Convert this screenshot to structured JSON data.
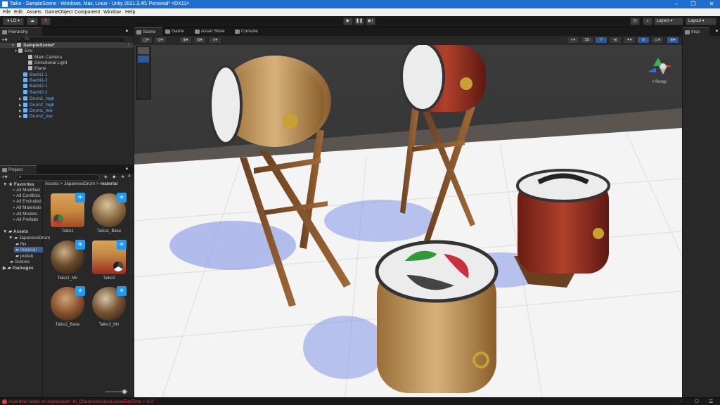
{
  "window": {
    "title": "Taiko - SampleScene - Windows, Mac, Linux - Unity 2021.3.4f1 Personal* <DX11>"
  },
  "menu": [
    "File",
    "Edit",
    "Assets",
    "GameObject",
    "Component",
    "Window",
    "Help"
  ],
  "toolbar": {
    "account": "LO",
    "layers_label": "Layers",
    "layout_label": "Layout"
  },
  "hierarchy": {
    "tab_label": "Hierarchy",
    "search_placeholder": "All",
    "scene": "SampleScene*",
    "items": [
      {
        "label": "Env",
        "kind": "folder"
      },
      {
        "label": "Main Camera",
        "kind": "go"
      },
      {
        "label": "Directional Light",
        "kind": "go"
      },
      {
        "label": "Plane",
        "kind": "go"
      },
      {
        "label": "Bachi1-1",
        "kind": "prefab"
      },
      {
        "label": "Bachi1-2",
        "kind": "prefab"
      },
      {
        "label": "Bachi2-1",
        "kind": "prefab"
      },
      {
        "label": "Bachi2-2",
        "kind": "prefab"
      },
      {
        "label": "Drum1_high",
        "kind": "prefab"
      },
      {
        "label": "Drum2_high",
        "kind": "prefab"
      },
      {
        "label": "Drum1_low",
        "kind": "prefab"
      },
      {
        "label": "Drum2_low",
        "kind": "prefab"
      }
    ]
  },
  "project": {
    "tab_label": "Project",
    "count_badge": "4",
    "favorites_label": "Favorites",
    "favorites": [
      "All Modified",
      "All Conflicts",
      "All Excluded",
      "All Materials",
      "All Models",
      "All Prefabs"
    ],
    "assets_label": "Assets",
    "assets_tree": [
      "JapaneseDrum",
      "fbx",
      "material",
      "prefab",
      "Scenes"
    ],
    "packages_label": "Packages",
    "breadcrumb": [
      "Assets",
      "JapaneseDrum",
      "material"
    ],
    "materials": [
      "Taiko1",
      "Taiko1_Base",
      "Taiko1_Mir",
      "Taiko2",
      "Taiko2_Base",
      "Taiko2_Mir"
    ]
  },
  "scene_tabs": [
    "Scene",
    "Game",
    "Asset Store",
    "Console"
  ],
  "scene": {
    "mode_2d": "2D",
    "persp_label": "< Persp"
  },
  "inspector": {
    "tab_label": "Insp"
  },
  "status": {
    "message": "Assertion failed on expression: 'm_ChannelAccessLeaseEndTime > 0.0'"
  },
  "colors": {
    "accent": "#1f6fd0",
    "panel": "#282828",
    "prefab_blue": "#6ab4ff",
    "error": "#e04040"
  }
}
